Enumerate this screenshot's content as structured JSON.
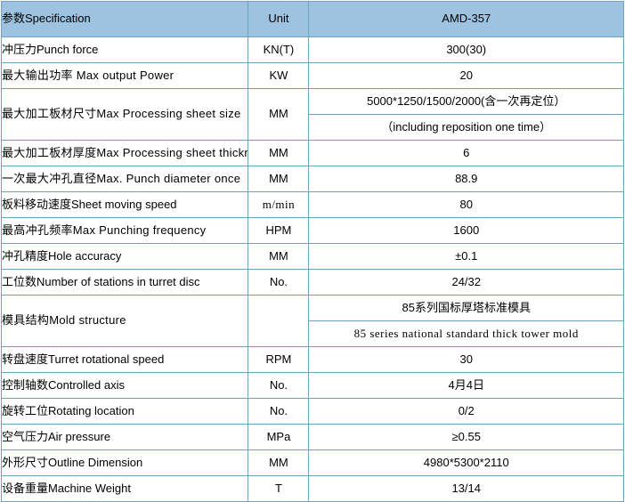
{
  "table": {
    "header": {
      "parameter": "参数Specification",
      "unit": "Unit",
      "model": "AMD-357"
    },
    "rows": [
      {
        "param": "冲压力Punch force",
        "unit": "KN(T)",
        "value": "300(30)"
      },
      {
        "param": "最大输出功率 Max  output  Power",
        "unit": "KW",
        "value": "20"
      },
      {
        "param": "最大加工板材尺寸Max  Processing sheet size",
        "unit": "MM",
        "value_lines": [
          "5000*1250/1500/2000(含一次再定位）",
          "（including reposition one time）"
        ]
      },
      {
        "param": "最大加工板材厚度Max  Processing sheet thickness",
        "unit": "MM",
        "value": "6"
      },
      {
        "param": "一次最大冲孔直径Max. Punch diameter  once",
        "unit": "MM",
        "value": "88.9"
      },
      {
        "param": "板料移动速度Sheet moving speed",
        "unit": "m/min",
        "value": "80"
      },
      {
        "param": "最高冲孔频率Max  Punching frequency",
        "unit": "HPM",
        "value": "1600"
      },
      {
        "param": "冲孔精度Hole accuracy",
        "unit": "MM",
        "value": "±0.1"
      },
      {
        "param": "工位数Number of stations in turret disc",
        "unit": "No.",
        "value": "24/32"
      },
      {
        "param": "模具结构Mold  structure",
        "unit": "",
        "value_lines": [
          "85系列国标厚塔标准模具",
          "85 series national standard thick tower mold"
        ]
      },
      {
        "param": "转盘速度Turret rotational speed",
        "unit": "RPM",
        "value": "30"
      },
      {
        "param": "控制轴数Controlled axis",
        "unit": "No.",
        "value": "4月4日"
      },
      {
        "param": "旋转工位Rotating location",
        "unit": "No.",
        "value": "0/2"
      },
      {
        "param": "空气压力Air pressure",
        "unit": "MPa",
        "value": "≥0.55"
      },
      {
        "param": "外形尺寸Outline Dimension",
        "unit": "MM",
        "value": "4980*5300*2110"
      },
      {
        "param": "设备重量Machine Weight",
        "unit": "T",
        "value": "13/14"
      }
    ]
  },
  "colors": {
    "header_bg": "#9dc3e0",
    "border": "#6fa3c4"
  }
}
